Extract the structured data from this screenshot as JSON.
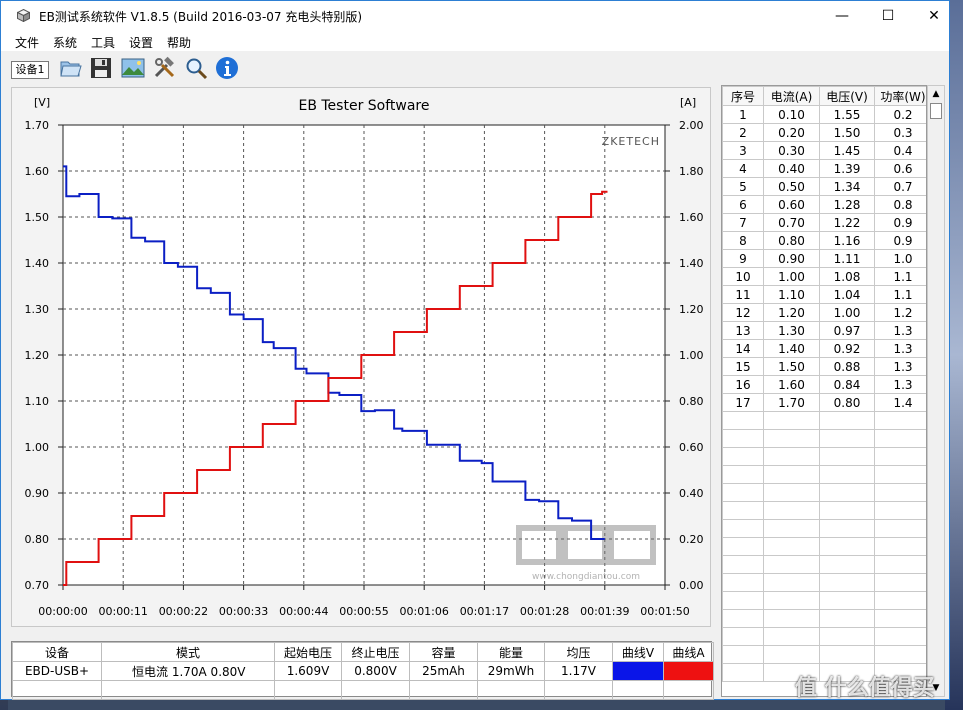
{
  "window": {
    "title": "EB测试系统软件 V1.8.5 (Build 2016-03-07 充电头特别版)",
    "min_glyph": "—",
    "max_glyph": "☐",
    "close_glyph": "✕"
  },
  "menu": [
    "文件",
    "系统",
    "工具",
    "设置",
    "帮助"
  ],
  "toolbar": {
    "device_tab": "设备1",
    "icons": [
      "folder-open-icon",
      "save-disk-icon",
      "landscape-image-icon",
      "tools-icon",
      "magnifier-icon",
      "info-icon"
    ]
  },
  "chart_data": {
    "type": "line",
    "title": "EB Tester Software",
    "brand": "ZKETECH",
    "watermark_text": "www.chongdiantou.com",
    "left_unit": "[V]",
    "right_unit": "[A]",
    "ylim": [
      0.7,
      1.7
    ],
    "y2lim": [
      0.0,
      2.0
    ],
    "xlim": [
      0,
      110
    ],
    "y_ticks": [
      "1.70",
      "1.60",
      "1.50",
      "1.40",
      "1.30",
      "1.20",
      "1.10",
      "1.00",
      "0.90",
      "0.80",
      "0.70"
    ],
    "y2_ticks": [
      "2.00",
      "1.80",
      "1.60",
      "1.40",
      "1.20",
      "1.00",
      "0.80",
      "0.60",
      "0.40",
      "0.20",
      "0.00"
    ],
    "x_ticks": [
      "00:00:00",
      "00:00:11",
      "00:00:22",
      "00:00:33",
      "00:00:44",
      "00:00:55",
      "00:01:06",
      "00:01:17",
      "00:01:28",
      "00:01:39",
      "00:01:50"
    ],
    "series": [
      {
        "color": "#0b1fc4",
        "axis": "left",
        "points": [
          [
            0,
            1.61
          ],
          [
            0.6,
            1.61
          ],
          [
            0.6,
            1.545
          ],
          [
            3,
            1.545
          ],
          [
            3,
            1.55
          ],
          [
            6.5,
            1.55
          ],
          [
            6.5,
            1.5
          ],
          [
            9,
            1.5
          ],
          [
            9,
            1.497
          ],
          [
            12.5,
            1.497
          ],
          [
            12.5,
            1.455
          ],
          [
            15,
            1.455
          ],
          [
            15,
            1.447
          ],
          [
            18.5,
            1.447
          ],
          [
            18.5,
            1.4
          ],
          [
            21,
            1.4
          ],
          [
            21,
            1.392
          ],
          [
            24.5,
            1.392
          ],
          [
            24.5,
            1.345
          ],
          [
            27,
            1.345
          ],
          [
            27,
            1.335
          ],
          [
            30.5,
            1.335
          ],
          [
            30.5,
            1.288
          ],
          [
            33,
            1.288
          ],
          [
            33,
            1.278
          ],
          [
            36.5,
            1.278
          ],
          [
            36.5,
            1.228
          ],
          [
            38.5,
            1.228
          ],
          [
            38.5,
            1.215
          ],
          [
            42.5,
            1.215
          ],
          [
            42.5,
            1.17
          ],
          [
            44.5,
            1.17
          ],
          [
            44.5,
            1.16
          ],
          [
            48.5,
            1.16
          ],
          [
            48.5,
            1.118
          ],
          [
            50.5,
            1.118
          ],
          [
            50.5,
            1.113
          ],
          [
            54.5,
            1.113
          ],
          [
            54.5,
            1.078
          ],
          [
            57,
            1.078
          ],
          [
            57,
            1.08
          ],
          [
            60.5,
            1.08
          ],
          [
            60.5,
            1.04
          ],
          [
            62,
            1.04
          ],
          [
            62,
            1.035
          ],
          [
            66.5,
            1.035
          ],
          [
            66.5,
            1.005
          ],
          [
            72.5,
            1.005
          ],
          [
            72.5,
            0.97
          ],
          [
            76.5,
            0.97
          ],
          [
            76.5,
            0.965
          ],
          [
            78.5,
            0.965
          ],
          [
            78.5,
            0.925
          ],
          [
            84.5,
            0.925
          ],
          [
            84.5,
            0.885
          ],
          [
            87,
            0.885
          ],
          [
            87,
            0.882
          ],
          [
            90.5,
            0.882
          ],
          [
            90.5,
            0.845
          ],
          [
            93,
            0.845
          ],
          [
            93,
            0.84
          ],
          [
            96.5,
            0.84
          ],
          [
            96.5,
            0.8
          ],
          [
            99,
            0.8
          ]
        ]
      },
      {
        "color": "#e01010",
        "axis": "right",
        "points": [
          [
            0,
            0.0
          ],
          [
            0.6,
            0.0
          ],
          [
            0.6,
            0.1
          ],
          [
            6.5,
            0.1
          ],
          [
            6.5,
            0.2
          ],
          [
            12.5,
            0.2
          ],
          [
            12.5,
            0.3
          ],
          [
            18.5,
            0.3
          ],
          [
            18.5,
            0.4
          ],
          [
            24.5,
            0.4
          ],
          [
            24.5,
            0.5
          ],
          [
            30.5,
            0.5
          ],
          [
            30.5,
            0.6
          ],
          [
            36.5,
            0.6
          ],
          [
            36.5,
            0.7
          ],
          [
            42.5,
            0.7
          ],
          [
            42.5,
            0.8
          ],
          [
            48.5,
            0.8
          ],
          [
            48.5,
            0.9
          ],
          [
            54.5,
            0.9
          ],
          [
            54.5,
            1.0
          ],
          [
            60.5,
            1.0
          ],
          [
            60.5,
            1.1
          ],
          [
            66.5,
            1.1
          ],
          [
            66.5,
            1.2
          ],
          [
            72.5,
            1.2
          ],
          [
            72.5,
            1.3
          ],
          [
            78.5,
            1.3
          ],
          [
            78.5,
            1.4
          ],
          [
            84.5,
            1.4
          ],
          [
            84.5,
            1.5
          ],
          [
            90.5,
            1.5
          ],
          [
            90.5,
            1.6
          ],
          [
            96.5,
            1.6
          ],
          [
            96.5,
            1.7
          ],
          [
            98.5,
            1.7
          ],
          [
            98.5,
            1.71
          ],
          [
            99.5,
            1.71
          ]
        ]
      }
    ]
  },
  "table": {
    "headers": [
      "序号",
      "电流(A)",
      "电压(V)",
      "功率(W)"
    ],
    "rows": [
      [
        "1",
        "0.10",
        "1.55",
        "0.2"
      ],
      [
        "2",
        "0.20",
        "1.50",
        "0.3"
      ],
      [
        "3",
        "0.30",
        "1.45",
        "0.4"
      ],
      [
        "4",
        "0.40",
        "1.39",
        "0.6"
      ],
      [
        "5",
        "0.50",
        "1.34",
        "0.7"
      ],
      [
        "6",
        "0.60",
        "1.28",
        "0.8"
      ],
      [
        "7",
        "0.70",
        "1.22",
        "0.9"
      ],
      [
        "8",
        "0.80",
        "1.16",
        "0.9"
      ],
      [
        "9",
        "0.90",
        "1.11",
        "1.0"
      ],
      [
        "10",
        "1.00",
        "1.08",
        "1.1"
      ],
      [
        "11",
        "1.10",
        "1.04",
        "1.1"
      ],
      [
        "12",
        "1.20",
        "1.00",
        "1.2"
      ],
      [
        "13",
        "1.30",
        "0.97",
        "1.3"
      ],
      [
        "14",
        "1.40",
        "0.92",
        "1.3"
      ],
      [
        "15",
        "1.50",
        "0.88",
        "1.3"
      ],
      [
        "16",
        "1.60",
        "0.84",
        "1.3"
      ],
      [
        "17",
        "1.70",
        "0.80",
        "1.4"
      ]
    ],
    "scroll_up": "▲",
    "scroll_down": "▼"
  },
  "summary": {
    "headers": [
      "设备",
      "模式",
      "起始电压",
      "终止电压",
      "容量",
      "能量",
      "均压",
      "曲线V",
      "曲线A"
    ],
    "values": [
      "EBD-USB+",
      "恒电流 1.70A 0.80V",
      "1.609V",
      "0.800V",
      "25mAh",
      "29mWh",
      "1.17V"
    ],
    "curve_v_color": "#0a15e8",
    "curve_a_color": "#ee1111"
  },
  "overlay": {
    "corner_watermark": "值 什么值得买"
  }
}
